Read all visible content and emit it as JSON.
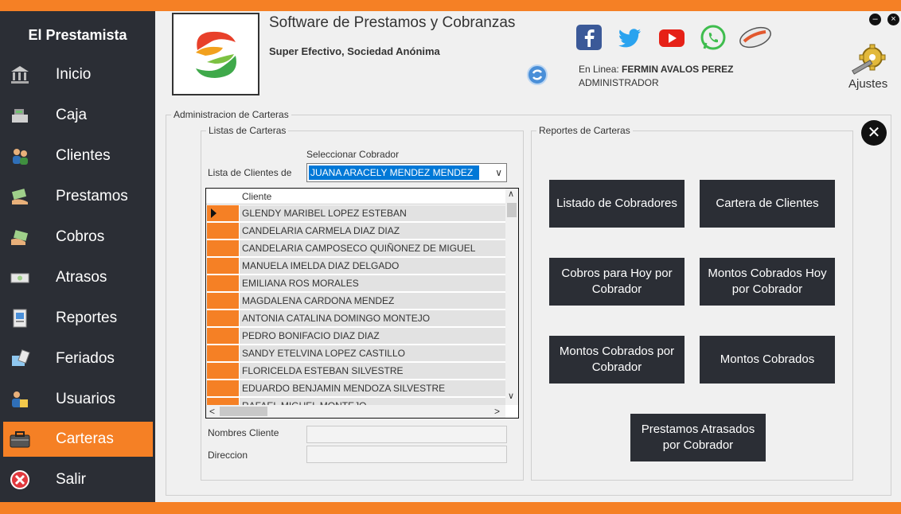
{
  "app": {
    "title": "Software de Prestamos y Cobranzas",
    "company": "Super Efectivo, Sociedad Anónima",
    "brand": "El Prestamista",
    "status_prefix": "En Linea: ",
    "user_name": "FERMIN AVALOS PEREZ",
    "user_role": "ADMINISTRADOR",
    "settings_label": "Ajustes",
    "accent_color": "#f58025",
    "dark_color": "#2b2e35"
  },
  "sidebar": {
    "items": [
      {
        "label": "Inicio",
        "icon": "bank-icon"
      },
      {
        "label": "Caja",
        "icon": "cash-register-icon"
      },
      {
        "label": "Clientes",
        "icon": "people-icon"
      },
      {
        "label": "Prestamos",
        "icon": "money-hand-icon"
      },
      {
        "label": "Cobros",
        "icon": "money-receive-icon"
      },
      {
        "label": "Atrasos",
        "icon": "money-late-icon"
      },
      {
        "label": "Reportes",
        "icon": "report-icon"
      },
      {
        "label": "Feriados",
        "icon": "calendar-icon"
      },
      {
        "label": "Usuarios",
        "icon": "users-icon"
      },
      {
        "label": "Carteras",
        "icon": "briefcase-icon"
      },
      {
        "label": "Salir",
        "icon": "exit-icon"
      }
    ],
    "active": "Carteras"
  },
  "social": [
    "facebook-icon",
    "twitter-icon",
    "youtube-icon",
    "whatsapp-icon",
    "mouse-icon"
  ],
  "main": {
    "section_title": "Administracion de Carteras",
    "list_group_title": "Listas de Carteras",
    "select_cobrador_label": "Seleccionar Cobrador",
    "list_clients_label": "Lista de Clientes de",
    "selected_cobrador": "JUANA  ARACELY MENDEZ MENDEZ",
    "grid_header": "Cliente",
    "clients": [
      "GLENDY MARIBEL LOPEZ ESTEBAN",
      "CANDELARIA CARMELA DIAZ DIAZ",
      "CANDELARIA CAMPOSECO QUIÑONEZ DE MIGUEL",
      "MANUELA IMELDA DIAZ DELGADO",
      "EMILIANA ROS MORALES",
      "MAGDALENA CARDONA MENDEZ",
      "ANTONIA CATALINA DOMINGO MONTEJO",
      "PEDRO BONIFACIO DIAZ DIAZ",
      "SANDY ETELVINA LOPEZ CASTILLO",
      "FLORICELDA ESTEBAN SILVESTRE",
      "EDUARDO BENJAMIN MENDOZA SILVESTRE",
      "RAFAEL MIGUEL MONTEJO"
    ],
    "nombre_label": "Nombres Cliente",
    "direccion_label": "Direccion",
    "nombre_value": "",
    "direccion_value": ""
  },
  "reports": {
    "group_title": "Reportes de Carteras",
    "buttons": [
      "Listado de Cobradores",
      "Cartera de Clientes",
      "Cobros para Hoy por Cobrador",
      "Montos Cobrados Hoy por Cobrador",
      "Montos Cobrados por Cobrador",
      "Montos Cobrados",
      "Prestamos Atrasados por Cobrador"
    ]
  }
}
